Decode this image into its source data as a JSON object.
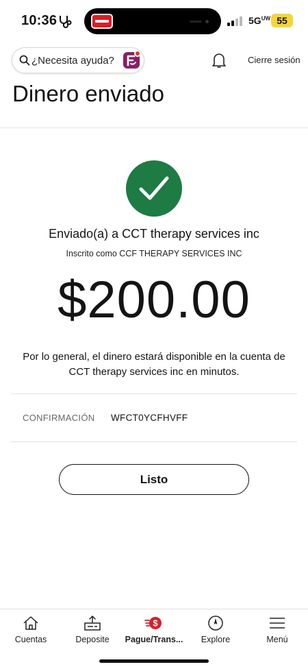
{
  "status_bar": {
    "time": "10:36",
    "network": "5G",
    "network_sup": "UW",
    "battery": "55"
  },
  "header": {
    "search_label": "¿Necesita ayuda?",
    "logout_label": "Cierre sesión"
  },
  "page": {
    "title": "Dinero enviado"
  },
  "confirmation": {
    "sent_to": "Enviado(a) a CCT therapy services inc",
    "enrolled_as": "Inscrito como CCF THERAPY SERVICES INC",
    "amount": "$200.00",
    "availability": "Por lo general, el dinero estará disponible en la cuenta de CCT therapy services inc en minutos.",
    "code_label": "CONFIRMACIÓN",
    "code_value": "WFCT0YCFHVFF",
    "done_label": "Listo",
    "success_color": "#1e7b43"
  },
  "bottom_nav": {
    "items": [
      {
        "label": "Cuentas",
        "icon": "home-icon"
      },
      {
        "label": "Deposite",
        "icon": "deposit-icon"
      },
      {
        "label": "Pague/Trans...",
        "icon": "pay-transfer-icon",
        "active": true
      },
      {
        "label": "Explore",
        "icon": "compass-icon"
      },
      {
        "label": "Menú",
        "icon": "hamburger-menu-icon"
      }
    ]
  },
  "colors": {
    "brand_red": "#d71e28",
    "status_battery": "#f4d63a"
  }
}
